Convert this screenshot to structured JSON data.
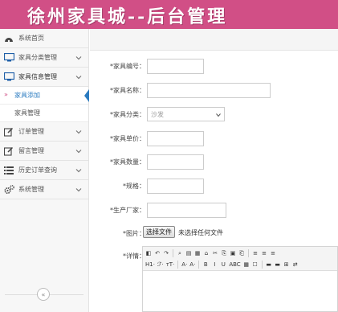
{
  "header": {
    "title": "徐州家具城--后台管理"
  },
  "sidebar": {
    "items": [
      {
        "label": "系统首页"
      },
      {
        "label": "家具分类管理"
      },
      {
        "label": "家具信息管理"
      },
      {
        "label": "订单管理"
      },
      {
        "label": "留言管理"
      },
      {
        "label": "历史订单查询"
      },
      {
        "label": "系统管理"
      }
    ],
    "subitems": [
      {
        "label": "家具添加"
      },
      {
        "label": "家具管理"
      }
    ],
    "collapse_glyph": "«"
  },
  "form": {
    "labels": {
      "code": "*家具编号：",
      "name": "*家具名称：",
      "category": "*家具分类：",
      "price": "*家具单价：",
      "quantity": "*家具数量：",
      "spec": "*规格：",
      "maker": "*生产厂家：",
      "image": "*图片：",
      "detail": "*详情："
    },
    "category_value": "沙发",
    "file_button": "选择文件",
    "file_status": "未选择任何文件"
  },
  "editor": {
    "row1": [
      "◧",
      "↶",
      "↷",
      "",
      "⌕",
      "▤",
      "▦",
      "⌂",
      "✂",
      "⎘",
      "▣",
      "⎗",
      "",
      "≡",
      "≡",
      "≡"
    ],
    "row2": [
      "H1·",
      "ℱ·",
      "ᴛT·",
      "",
      "A·",
      "A·",
      "",
      "B",
      "I",
      "U",
      "ABC",
      "▦",
      "☐",
      "",
      "▬",
      "▬",
      "⊞",
      "⇄"
    ]
  },
  "colors": {
    "header": "#d14f86",
    "accent": "#2b7bc0"
  }
}
